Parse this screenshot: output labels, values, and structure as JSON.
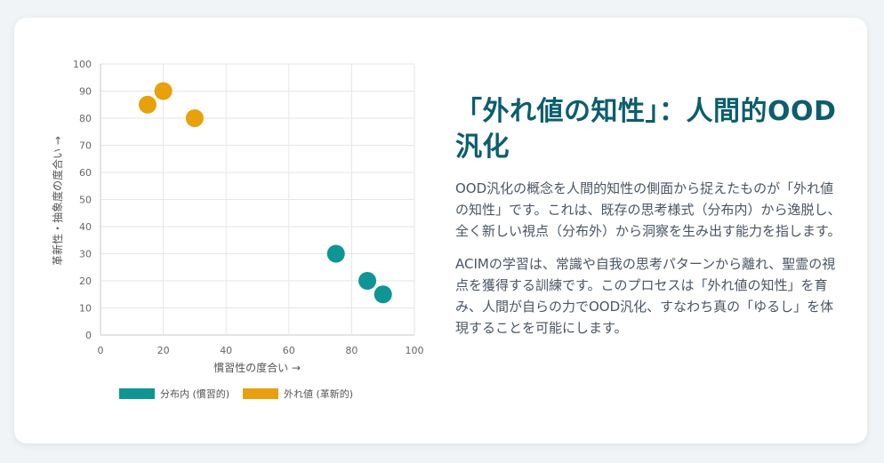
{
  "headline": "「外れ値の知性」：人間的OOD汎化",
  "paragraphs": [
    "OOD汎化の概念を人間的知性の側面から捉えたものが「外れ値の知性」です。これは、既存の思考様式（分布内）から逸脱し、全く新しい視点（分布外）から洞察を生み出す能力を指します。",
    "ACIMの学習は、常識や自我の思考パターンから離れ、聖霊の視点を獲得する訓練です。このプロセスは「外れ値の知性」を育み、人間が自らの力でOOD汎化、すなわち真の「ゆるし」を体現することを可能にします。"
  ],
  "colors": {
    "in_dist": "#0e9594",
    "outlier": "#e8a00c",
    "headline": "#0b5e6e"
  },
  "chart_data": {
    "type": "scatter",
    "xlabel": "慣習性の度合い →",
    "ylabel": "革新性・抽象度の度合い →",
    "xlim": [
      0,
      100
    ],
    "ylim": [
      0,
      100
    ],
    "xticks": [
      0,
      20,
      40,
      60,
      80,
      100
    ],
    "yticks": [
      0,
      10,
      20,
      30,
      40,
      50,
      60,
      70,
      80,
      90,
      100
    ],
    "grid": true,
    "legend_position": "bottom",
    "series": [
      {
        "name": "分布内 (慣習的)",
        "color": "#0e9594",
        "points": [
          [
            75,
            30
          ],
          [
            85,
            20
          ],
          [
            90,
            15
          ]
        ]
      },
      {
        "name": "外れ値 (革新的)",
        "color": "#e8a00c",
        "points": [
          [
            15,
            85
          ],
          [
            20,
            90
          ],
          [
            30,
            80
          ]
        ]
      }
    ]
  }
}
